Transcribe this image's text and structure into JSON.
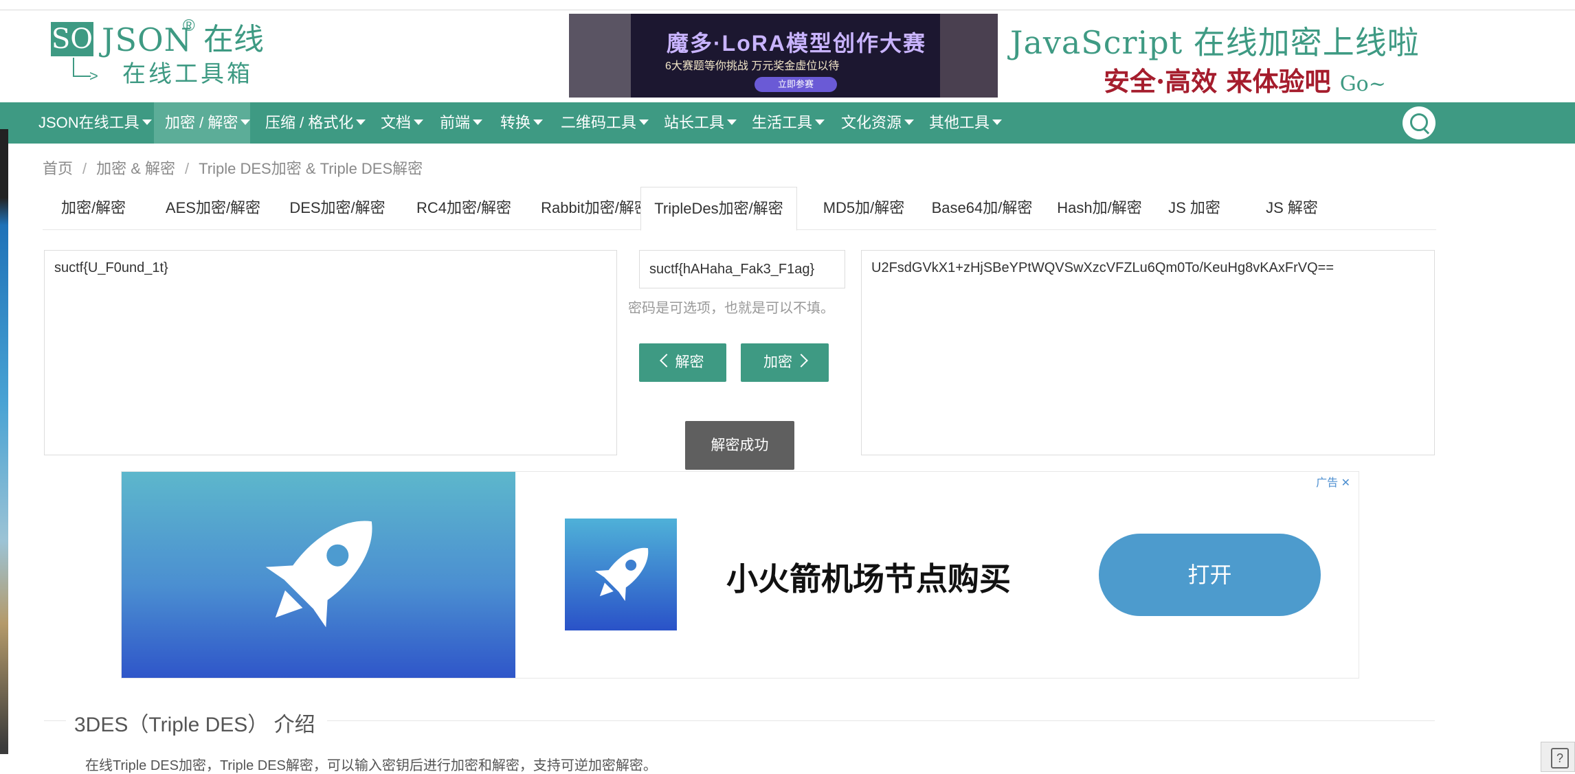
{
  "header": {
    "logo_box": "SO",
    "logo_json": "JSON",
    "logo_reg": "®",
    "logo_zaixian": "在线",
    "logo_sub": "在线工具箱",
    "banner_title": "魔多·LoRA模型创作大赛",
    "banner_sub": "6大赛题等你挑战  万元奖金虚位以待",
    "banner_btn": "立即参赛",
    "promo_line1": "JavaScript 在线加密上线啦",
    "promo_line2": "安全·高效 来体验吧",
    "promo_go": "Go~"
  },
  "nav": {
    "items": [
      {
        "label": "JSON在线工具"
      },
      {
        "label": "加密 / 解密"
      },
      {
        "label": "压缩 / 格式化"
      },
      {
        "label": "文档"
      },
      {
        "label": "前端"
      },
      {
        "label": "转换"
      },
      {
        "label": "二维码工具"
      },
      {
        "label": "站长工具"
      },
      {
        "label": "生活工具"
      },
      {
        "label": "文化资源"
      },
      {
        "label": "其他工具"
      }
    ],
    "active_index": 1
  },
  "breadcrumb": {
    "items": [
      "首页",
      "加密 & 解密",
      "Triple DES加密 & Triple DES解密"
    ],
    "separator": "/"
  },
  "tabs": {
    "items": [
      {
        "label": "加密/解密"
      },
      {
        "label": "AES加密/解密"
      },
      {
        "label": "DES加密/解密"
      },
      {
        "label": "RC4加密/解密"
      },
      {
        "label": "Rabbit加密/解密"
      },
      {
        "label": "TripleDes加密/解密"
      },
      {
        "label": "MD5加/解密"
      },
      {
        "label": "Base64加/解密"
      },
      {
        "label": "Hash加/解密"
      },
      {
        "label": "JS 加密"
      },
      {
        "label": "JS 解密"
      }
    ],
    "active_index": 5
  },
  "tool": {
    "plaintext": "suctf{U_F0und_1t}",
    "key": "suctf{hAHaha_Fak3_F1ag}",
    "key_hint": "密码是可选项，也就是可以不填。",
    "decrypt_label": "解密",
    "encrypt_label": "加密",
    "ciphertext": "U2FsdGVkX1+zHjSBeYPtWQVSwXzcVFZLu6Qm0To/KeuHg8vKAxFrVQ==",
    "toast": "解密成功"
  },
  "ad": {
    "label": "广告",
    "close": "✕",
    "text": "小火箭机场节点购买",
    "open_button": "打开"
  },
  "intro": {
    "title": "3DES（Triple DES） 介绍",
    "text": "在线Triple DES加密，Triple DES解密，可以输入密钥后进行加密和解密，支持可逆加密解密。"
  },
  "colors": {
    "brand": "#3e9a83",
    "nav_active": "#5cad98",
    "toast_bg": "#5f5f5f",
    "ad_button": "#4d9bcd",
    "promo_red": "#a51d2d"
  }
}
